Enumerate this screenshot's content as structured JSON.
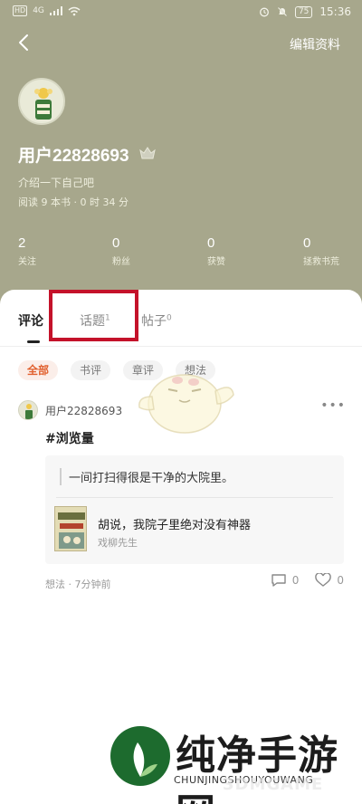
{
  "status_bar": {
    "carrier": "HD",
    "network": "4G",
    "battery": "75",
    "time": "15:36"
  },
  "header": {
    "edit_label": "编辑资料"
  },
  "profile": {
    "username": "用户22828693",
    "bio": "介绍一下自己吧",
    "reading": "阅读 9 本书 · 0 时 34 分"
  },
  "stats": [
    {
      "value": "2",
      "label": "关注"
    },
    {
      "value": "0",
      "label": "粉丝"
    },
    {
      "value": "0",
      "label": "获赞"
    },
    {
      "value": "0",
      "label": "拯救书荒"
    }
  ],
  "tabs": [
    {
      "label": "评论",
      "count": ""
    },
    {
      "label": "话题",
      "count": "1"
    },
    {
      "label": "帖子",
      "count": "0"
    }
  ],
  "filters": [
    "全部",
    "书评",
    "章评",
    "想法"
  ],
  "post": {
    "username": "用户22828693",
    "hashtag": "#浏览量",
    "quote": "一间打扫得很是干净的大院里。",
    "book_title": "胡说，我院子里绝对没有神器",
    "book_author": "戏柳先生",
    "type": "想法",
    "time": "7分钟前",
    "comments": "0",
    "likes": "0"
  },
  "watermark": {
    "title": "纯净手游网",
    "subtitle": "CHUNJINGSHOUYOUWANG",
    "overlay": "3DMGAME"
  },
  "colors": {
    "header_bg": "#a7a78c",
    "accent": "#e1602e",
    "highlight": "#c4122a"
  }
}
